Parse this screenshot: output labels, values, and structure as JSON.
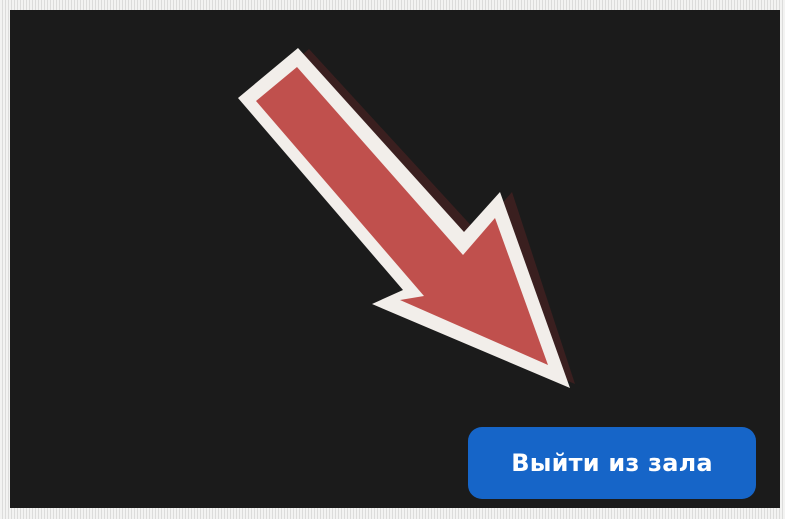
{
  "leave_button": {
    "label": "Выйти из зала"
  },
  "colors": {
    "panel_background": "#1b1b1b",
    "button_background": "#1665c8",
    "button_text": "#ffffff",
    "arrow_fill": "#c0504d",
    "arrow_outline": "#f2eeea"
  },
  "annotation": {
    "icon": "arrow-down-right-icon"
  }
}
